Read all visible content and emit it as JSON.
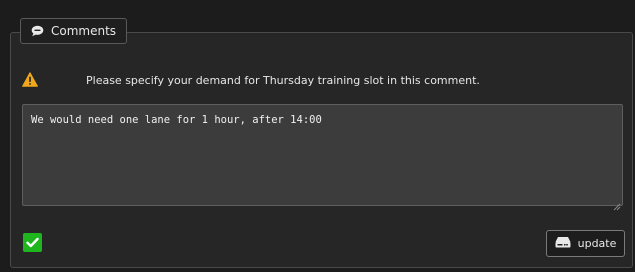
{
  "panel": {
    "legend_label": "Comments",
    "legend_icon": "comment-icon"
  },
  "notice": {
    "icon": "warning-icon",
    "icon_color": "#f0a81c",
    "text": "Please specify your demand for Thursday training slot in this comment."
  },
  "comment": {
    "value": "We would need one lane for 1 hour, after 14:00"
  },
  "confirm": {
    "checked": true,
    "color": "#1fb51f",
    "icon": "check-icon"
  },
  "update_button": {
    "label": "update",
    "icon": "hard-drive-icon"
  }
}
